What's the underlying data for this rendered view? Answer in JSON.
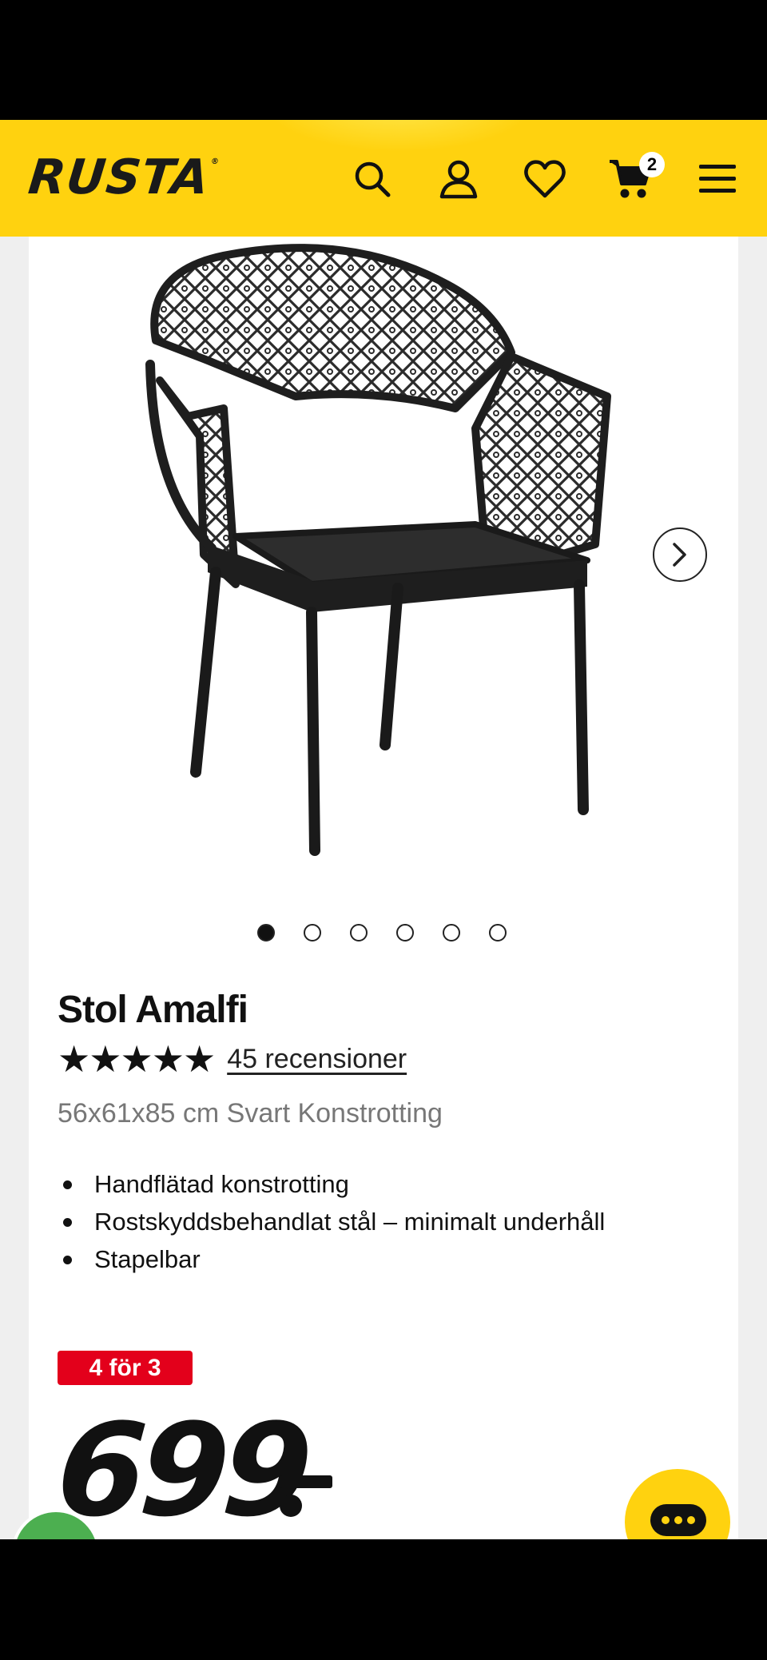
{
  "header": {
    "logo_text": "RUSTA",
    "logo_mark": "®",
    "icons": [
      "search-icon",
      "account-icon",
      "heart-icon",
      "cart-icon",
      "menu-icon"
    ],
    "cart_count": "2",
    "brand_color": "#ffd20f"
  },
  "gallery": {
    "image_alt": "Stol Amalfi",
    "dot_count": 6,
    "active_dot": 0,
    "next_icon": "chevron-right-icon"
  },
  "product": {
    "title": "Stol Amalfi",
    "stars": "★★★★★",
    "rating": 5,
    "reviews_label": "45 recensioner",
    "subtitle": "56x61x85 cm Svart Konstrotting",
    "features": [
      "Handflätad konstrotting",
      "Rostskyddsbehandlat stål – minimalt underhåll",
      "Stapelbar"
    ],
    "promo_label": "4 för 3",
    "promo_color": "#e3001b",
    "price": "699"
  },
  "floating": {
    "chat_icon": "chat-icon",
    "eco_icon": "eco-badge-icon"
  }
}
